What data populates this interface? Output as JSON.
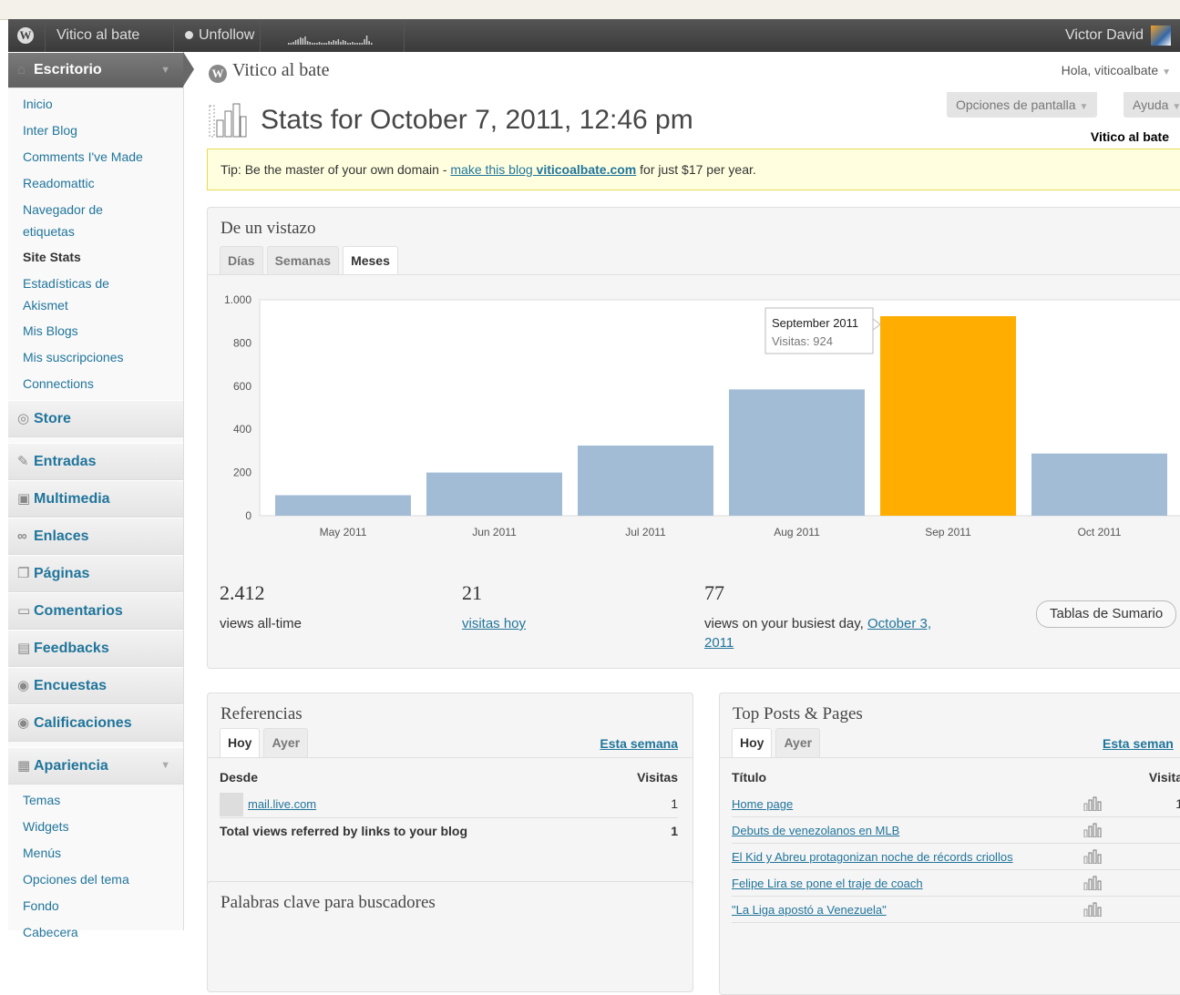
{
  "adminbar": {
    "site": "Vitico al bate",
    "unfollow": "Unfollow",
    "user": "Victor David"
  },
  "sidebar": {
    "dashboard": "Escritorio",
    "dashboard_items": [
      "Inicio",
      "Inter Blog",
      "Comments I've Made",
      "Readomattic",
      "Navegador de etiquetas",
      "Site Stats",
      "Estadísticas de Akismet",
      "Mis Blogs",
      "Mis suscripciones",
      "Connections"
    ],
    "store": "Store",
    "entradas": "Entradas",
    "multimedia": "Multimedia",
    "enlaces": "Enlaces",
    "paginas": "Páginas",
    "comentarios": "Comentarios",
    "feedbacks": "Feedbacks",
    "encuestas": "Encuestas",
    "calificaciones": "Calificaciones",
    "apariencia": "Apariencia",
    "apariencia_items": [
      "Temas",
      "Widgets",
      "Menús",
      "Opciones del tema",
      "Fondo",
      "Cabecera"
    ]
  },
  "header": {
    "site_title": "Vitico al bate",
    "howdy": "Hola, viticoalbate",
    "screen_options": "Opciones de pantalla",
    "help": "Ayuda",
    "page_title": "Stats for October 7, 2011, 12:46 pm",
    "blog_name": "Vitico al bate"
  },
  "tip": {
    "prefix": "Tip: Be the master of your own domain - ",
    "link_text": "make this blog ",
    "domain": "viticoalbate.com",
    "suffix": " for just $17 per year."
  },
  "glance": {
    "title": "De un vistazo",
    "tabs": [
      "Días",
      "Semanas",
      "Meses"
    ],
    "active_tab": 2,
    "alltime_value": "2.412",
    "alltime_label": "views all-time",
    "today_value": "21",
    "today_label": "visitas hoy",
    "busiest_value": "77",
    "busiest_label": "views on your busiest day, ",
    "busiest_link": "October 3, 2011",
    "summary_button": "Tablas de Sumario"
  },
  "chart_data": {
    "type": "bar",
    "categories": [
      "May 2011",
      "Jun 2011",
      "Jul 2011",
      "Aug 2011",
      "Sep 2011",
      "Oct 2011"
    ],
    "values": [
      95,
      200,
      325,
      585,
      924,
      288
    ],
    "highlight_index": 4,
    "ylim": [
      0,
      1000
    ],
    "yticks": [
      "0",
      "200",
      "400",
      "600",
      "800",
      "1.000"
    ],
    "tooltip_title": "September 2011",
    "tooltip_value": "Visitas: 924",
    "bar_color": "#a3bcd5",
    "highlight_color": "#ffad00",
    "grid": false
  },
  "referrers": {
    "title": "Referencias",
    "tabs": [
      "Hoy",
      "Ayer"
    ],
    "week_link": "Esta semana",
    "col_from": "Desde",
    "col_views": "Visitas",
    "rows": [
      {
        "name": "mail.live.com",
        "views": "1"
      }
    ],
    "total_label": "Total views referred by links to your blog",
    "total_value": "1"
  },
  "keywords": {
    "title": "Palabras clave para buscadores"
  },
  "topposts": {
    "title": "Top Posts & Pages",
    "tabs": [
      "Hoy",
      "Ayer"
    ],
    "week_link": "Esta seman",
    "col_title": "Título",
    "col_views": "Visita",
    "rows": [
      {
        "name": "Home page",
        "views": "1"
      },
      {
        "name": "Debuts de venezolanos en MLB",
        "views": ""
      },
      {
        "name": "El Kid y Abreu protagonizan noche de récords criollos",
        "views": ""
      },
      {
        "name": "Felipe Lira se pone el traje de coach",
        "views": ""
      },
      {
        "name": "\"La Liga apostó a Venezuela\"",
        "views": ""
      }
    ]
  },
  "colors": {
    "adminbar": "#464646",
    "link": "#21759b",
    "tip_bg": "#ffffe0"
  }
}
